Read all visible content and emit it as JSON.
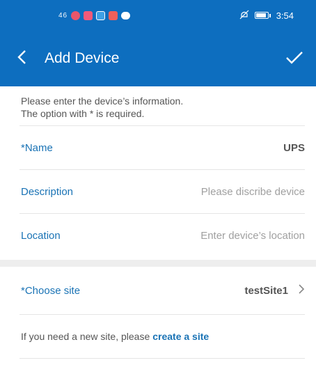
{
  "status": {
    "signal": "46",
    "time": "3:54"
  },
  "toolbar": {
    "title": "Add Device",
    "back_icon": "chevron-left-icon",
    "confirm_icon": "check-icon"
  },
  "intro": {
    "line1": "Please enter the device’s information.",
    "line2": "The option with * is required."
  },
  "fields": {
    "name": {
      "label": "*Name",
      "value": "UPS"
    },
    "description": {
      "label": "Description",
      "placeholder": "Please discribe device"
    },
    "location": {
      "label": "Location",
      "placeholder": "Enter device’s location"
    }
  },
  "site": {
    "label": "*Choose site",
    "value": "testSite1"
  },
  "hint": {
    "text": "If you need a new site, please",
    "link": "create a site"
  },
  "colors": {
    "primary": "#0d6ebf",
    "link": "#1a73b5"
  }
}
